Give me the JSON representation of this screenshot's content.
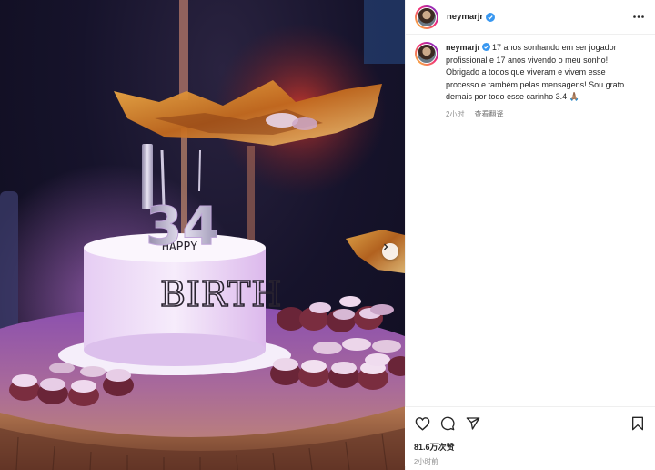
{
  "post": {
    "author": "neymarjr",
    "caption": "17 anos sonhando em ser jogador profissional e 17 anos vivendo o meu sonho! Obrigado a todos que viveram e vivem esse processo e também pelas mensagens! Sou grato demais por todo esse carinho 3.4 🙏🏽",
    "time_ago": "2小时",
    "translate_label": "查看翻译",
    "likes": "81.6万次赞",
    "footer_time": "2小时前"
  },
  "photo": {
    "candle_text": "34",
    "cake_text": "BIRTH",
    "cake_text_top": "HAPPY"
  },
  "colors": {
    "accent_blue": "#3897f0",
    "text_primary": "#262626",
    "text_secondary": "#8e8e8e",
    "purple_light": "#c86bdc",
    "amber_light": "#d28a2c"
  },
  "icons": {
    "verified": "verified-badge-icon",
    "more": "more-options-icon",
    "like": "heart-icon",
    "comment": "comment-icon",
    "share": "share-icon",
    "save": "bookmark-icon",
    "next": "chevron-right-icon"
  }
}
